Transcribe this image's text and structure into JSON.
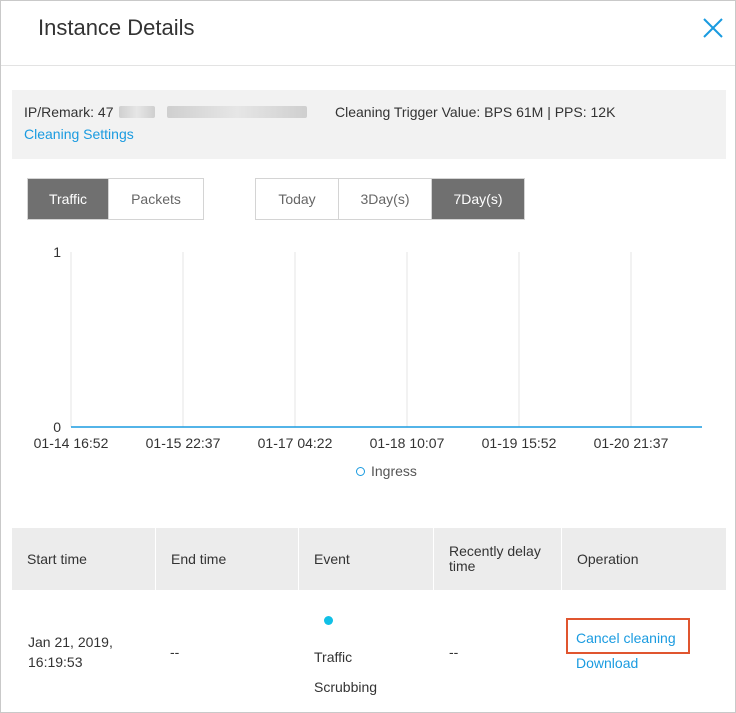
{
  "dialog": {
    "title": "Instance Details"
  },
  "info": {
    "ip_label": "IP/Remark: 47",
    "trigger_value": "Cleaning Trigger Value: BPS 61M | PPS: 12K",
    "settings_link": "Cleaning Settings"
  },
  "metric_tabs": [
    {
      "label": "Traffic",
      "active": true
    },
    {
      "label": "Packets",
      "active": false
    }
  ],
  "range_tabs": [
    {
      "label": "Today",
      "active": false
    },
    {
      "label": "3Day(s)",
      "active": false
    },
    {
      "label": "7Day(s)",
      "active": true
    }
  ],
  "chart_data": {
    "type": "line",
    "ylim": [
      0,
      1
    ],
    "y_ticks": [
      "0",
      "1"
    ],
    "x_ticks": [
      "01-14 16:52",
      "01-15 22:37",
      "01-17 04:22",
      "01-18 10:07",
      "01-19 15:52",
      "01-20 21:37"
    ],
    "series": [
      {
        "name": "Ingress",
        "color": "#1a9be0",
        "values": [
          0,
          0,
          0,
          0,
          0,
          0,
          0
        ]
      }
    ],
    "grid": true,
    "legend": "bottom-center"
  },
  "table": {
    "headers": [
      "Start time",
      "End time",
      "Event",
      "Recently delay time",
      "Operation"
    ],
    "row": {
      "start_time_line1": "Jan 21, 2019,",
      "start_time_line2": "16:19:53",
      "end_time": "--",
      "event_line1": "Traffic",
      "event_line2": "Scrubbing",
      "event_color": "#11c0e6",
      "delay": "--",
      "op_cancel": "Cancel cleaning",
      "op_download": "Download"
    }
  },
  "colors": {
    "accent": "#1a9be0",
    "active_tab": "#707070",
    "highlight": "#e0552f"
  }
}
